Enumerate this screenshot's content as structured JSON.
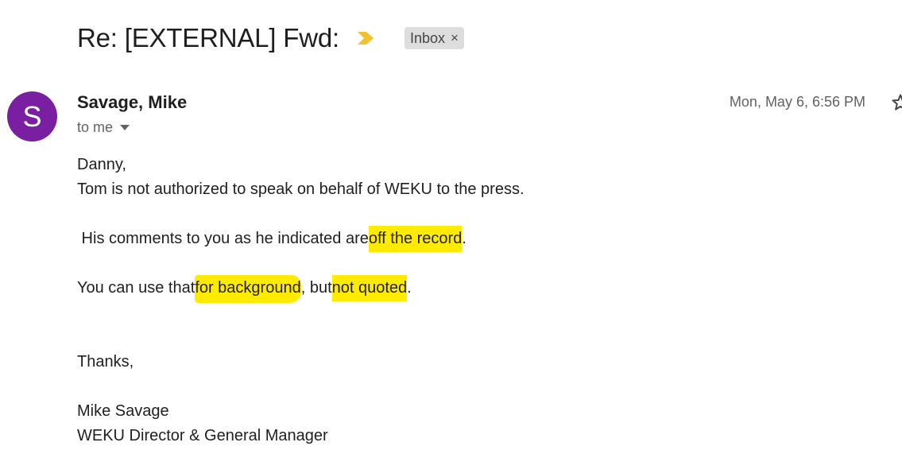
{
  "email": {
    "subject": "Re: [EXTERNAL] Fwd:",
    "importance_icon": "important-marker-icon",
    "label": "Inbox",
    "label_remove": "×",
    "sender": {
      "avatar_letter": "S",
      "name": "Savage, Mike",
      "recipient": "to me"
    },
    "timestamp": "Mon, May 6, 6:56 PM"
  },
  "body": {
    "greeting": "Danny,",
    "line1": "Tom is not authorized to speak on behalf of WEKU to the press.",
    "line2_prefix": " His comments to you as he indicated are",
    "line2_highlight": "off the record",
    "line2_suffix": ".",
    "line3_prefix": "You can use that",
    "line3_highlight1": "for background",
    "line3_middle": ", but",
    "line3_highlight2": "not quoted",
    "line3_suffix": ".",
    "closing": "Thanks,",
    "signature_name": "Mike Savage",
    "signature_title": "WEKU Director & General Manager"
  },
  "colors": {
    "avatar": "#7b1fa2",
    "highlight": "#ffeb00",
    "importance": "#f2c12e",
    "chip": "#dddddd"
  }
}
